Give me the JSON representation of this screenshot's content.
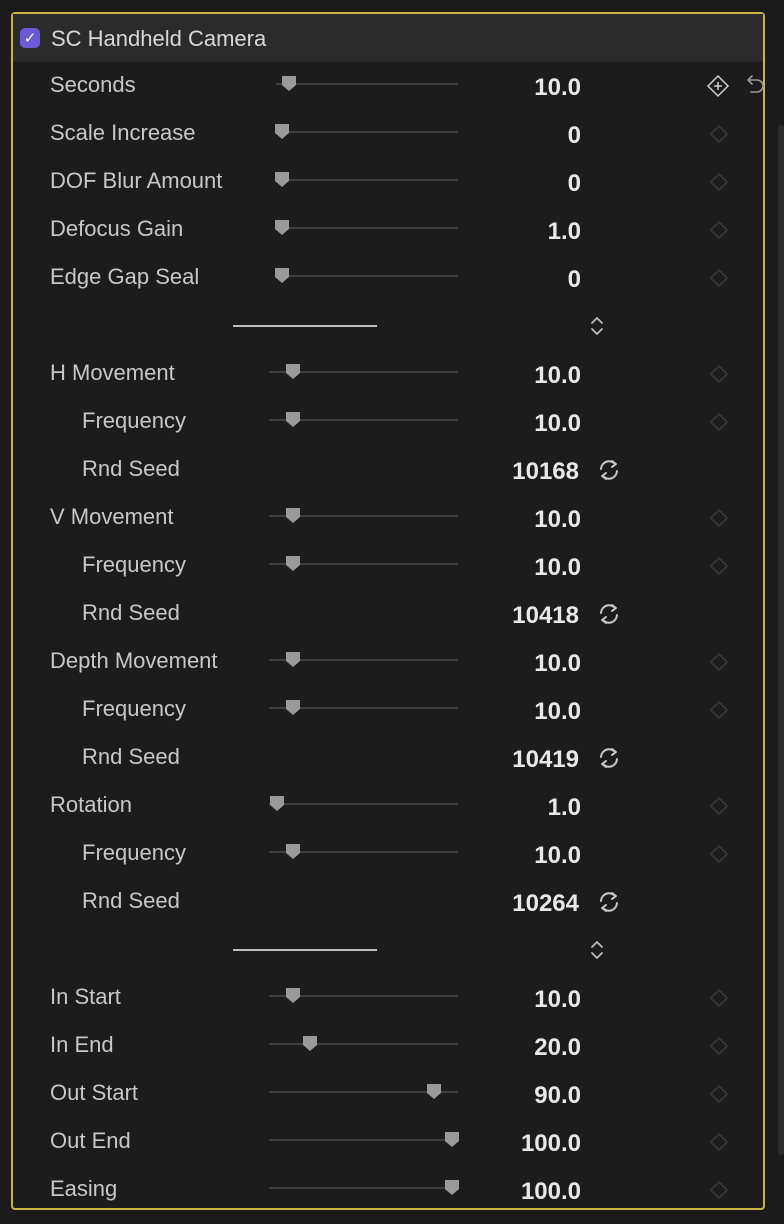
{
  "effect": {
    "title": "SC Handheld Camera",
    "enabled": true
  },
  "sections": [
    {
      "rows": [
        {
          "label": "Seconds",
          "value": "10.0",
          "level": 0,
          "slider": 0.04,
          "track": 0
        },
        {
          "label": "Scale Increase",
          "value": "0",
          "level": 0,
          "slider": 0.0,
          "track": 0
        },
        {
          "label": "DOF Blur Amount",
          "value": "0",
          "level": 0,
          "slider": 0.0,
          "track": 0
        },
        {
          "label": "Defocus Gain",
          "value": "1.0",
          "level": 0,
          "slider": 0.0,
          "track": 0
        },
        {
          "label": "Edge Gap Seal",
          "value": "0",
          "level": 0,
          "slider": 0.0,
          "track": 0
        }
      ]
    },
    {
      "rows": [
        {
          "label": "H Movement",
          "value": "10.0",
          "level": 0,
          "slider": 0.1,
          "track": 1
        },
        {
          "label": "Frequency",
          "value": "10.0",
          "level": 1,
          "slider": 0.1,
          "track": 1
        },
        {
          "label": "Rnd Seed",
          "value": "10168",
          "level": 1,
          "seed": true
        },
        {
          "label": "V Movement",
          "value": "10.0",
          "level": 0,
          "slider": 0.1,
          "track": 1
        },
        {
          "label": "Frequency",
          "value": "10.0",
          "level": 1,
          "slider": 0.1,
          "track": 1
        },
        {
          "label": "Rnd Seed",
          "value": "10418",
          "level": 1,
          "seed": true
        },
        {
          "label": "Depth Movement",
          "value": "10.0",
          "level": 0,
          "slider": 0.1,
          "track": 1
        },
        {
          "label": "Frequency",
          "value": "10.0",
          "level": 1,
          "slider": 0.1,
          "track": 1
        },
        {
          "label": "Rnd Seed",
          "value": "10419",
          "level": 1,
          "seed": true
        },
        {
          "label": "Rotation",
          "value": "1.0",
          "level": 0,
          "slider": 0.01,
          "track": 1
        },
        {
          "label": "Frequency",
          "value": "10.0",
          "level": 1,
          "slider": 0.1,
          "track": 1
        },
        {
          "label": "Rnd Seed",
          "value": "10264",
          "level": 1,
          "seed": true
        }
      ]
    },
    {
      "rows": [
        {
          "label": "In Start",
          "value": "10.0",
          "level": 0,
          "slider": 0.1,
          "track": 1
        },
        {
          "label": "In End",
          "value": "20.0",
          "level": 0,
          "slider": 0.2,
          "track": 1
        },
        {
          "label": "Out Start",
          "value": "90.0",
          "level": 0,
          "slider": 0.9,
          "track": 1
        },
        {
          "label": "Out End",
          "value": "100.0",
          "level": 0,
          "slider": 1.0,
          "track": 1
        },
        {
          "label": "Easing",
          "value": "100.0",
          "level": 0,
          "slider": 1.0,
          "track": 1
        }
      ]
    }
  ],
  "icons": {
    "checkbox": "checkmark-icon",
    "add_keyframe": "add-keyframe-icon",
    "reset": "reset-arrow-icon",
    "keyframe": "keyframe-diamond-icon",
    "reseed": "refresh-icon",
    "expand": "chevron-updown-icon"
  },
  "colors": {
    "accent": "#6a5ad8",
    "selection_border": "#c9b642",
    "background": "#1c1c1c"
  }
}
